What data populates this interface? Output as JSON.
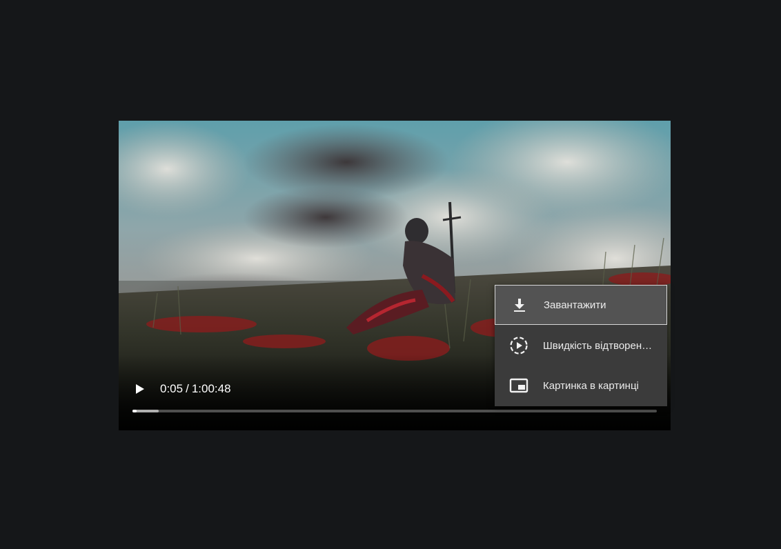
{
  "player": {
    "current_time": "0:05",
    "separator": "/",
    "duration": "1:00:48",
    "progress": {
      "played_fraction": 0.0014,
      "buffered_fraction": 0.05
    }
  },
  "context_menu": {
    "items": [
      {
        "label": "Завантажити",
        "icon": "download-icon"
      },
      {
        "label": "Швидкість відтворен…",
        "icon": "playback-speed-icon"
      },
      {
        "label": "Картинка в картинці",
        "icon": "picture-in-picture-icon"
      }
    ]
  },
  "colors": {
    "page_background": "#151719",
    "menu_background": "#3b3b3b",
    "menu_highlight": "#535353"
  }
}
